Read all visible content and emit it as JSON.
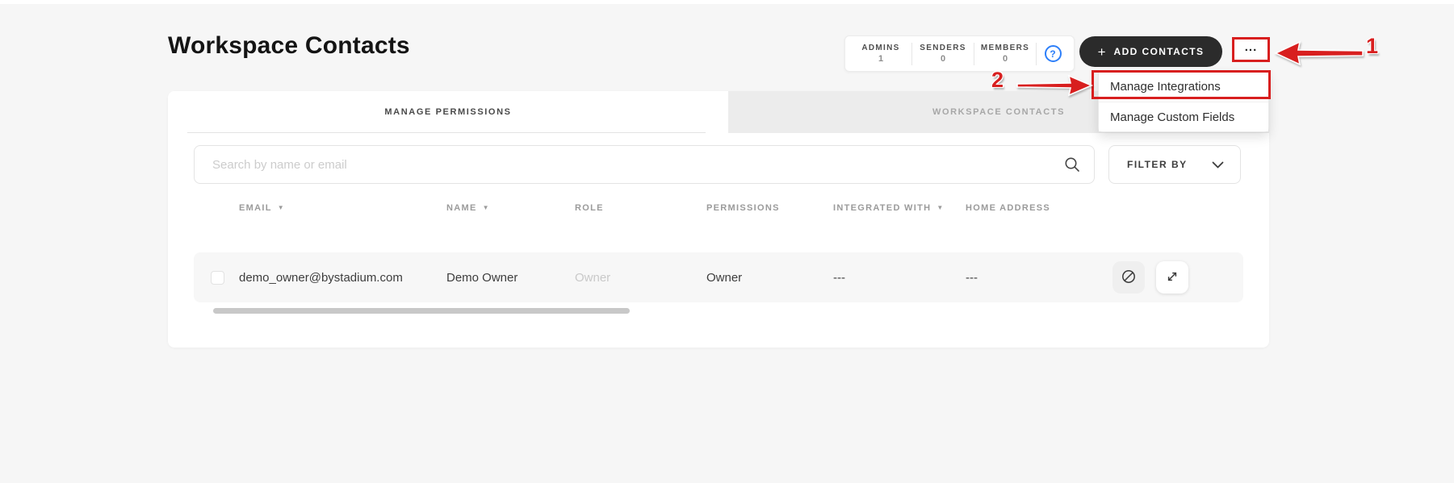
{
  "page": {
    "title": "Workspace Contacts"
  },
  "stats": {
    "items": [
      {
        "label": "ADMINS",
        "value": "1"
      },
      {
        "label": "SENDERS",
        "value": "0"
      },
      {
        "label": "MEMBERS",
        "value": "0"
      }
    ],
    "help_glyph": "?"
  },
  "toolbar": {
    "add_contacts_plus": "+",
    "add_contacts_label": "ADD CONTACTS",
    "more_label": "..."
  },
  "menu": {
    "items": [
      {
        "label": "Manage Integrations"
      },
      {
        "label": "Manage Custom Fields"
      }
    ]
  },
  "tabs": [
    {
      "label": "MANAGE PERMISSIONS"
    },
    {
      "label": "WORKSPACE CONTACTS"
    }
  ],
  "search": {
    "placeholder": "Search by name or email"
  },
  "filter": {
    "label": "FILTER BY"
  },
  "table": {
    "columns": [
      {
        "label": "EMAIL",
        "sortable": true
      },
      {
        "label": "NAME",
        "sortable": true
      },
      {
        "label": "ROLE",
        "sortable": false
      },
      {
        "label": "PERMISSIONS",
        "sortable": false
      },
      {
        "label": "INTEGRATED WITH",
        "sortable": true
      },
      {
        "label": "HOME ADDRESS",
        "sortable": false
      }
    ],
    "sort_caret": "▼",
    "rows": [
      {
        "email": "demo_owner@bystadium.com",
        "name": "Demo Owner",
        "role": "Owner",
        "permissions": "Owner",
        "integrated_with": "---",
        "home_address": "---"
      }
    ]
  },
  "annotations": {
    "step1": "1",
    "step2": "2"
  },
  "colors": {
    "annotation_red": "#d81f1f",
    "button_black": "#2b2b2b",
    "help_blue": "#2d7ff9",
    "page_background": "#f6f6f6",
    "row_background": "#f7f7f7"
  }
}
